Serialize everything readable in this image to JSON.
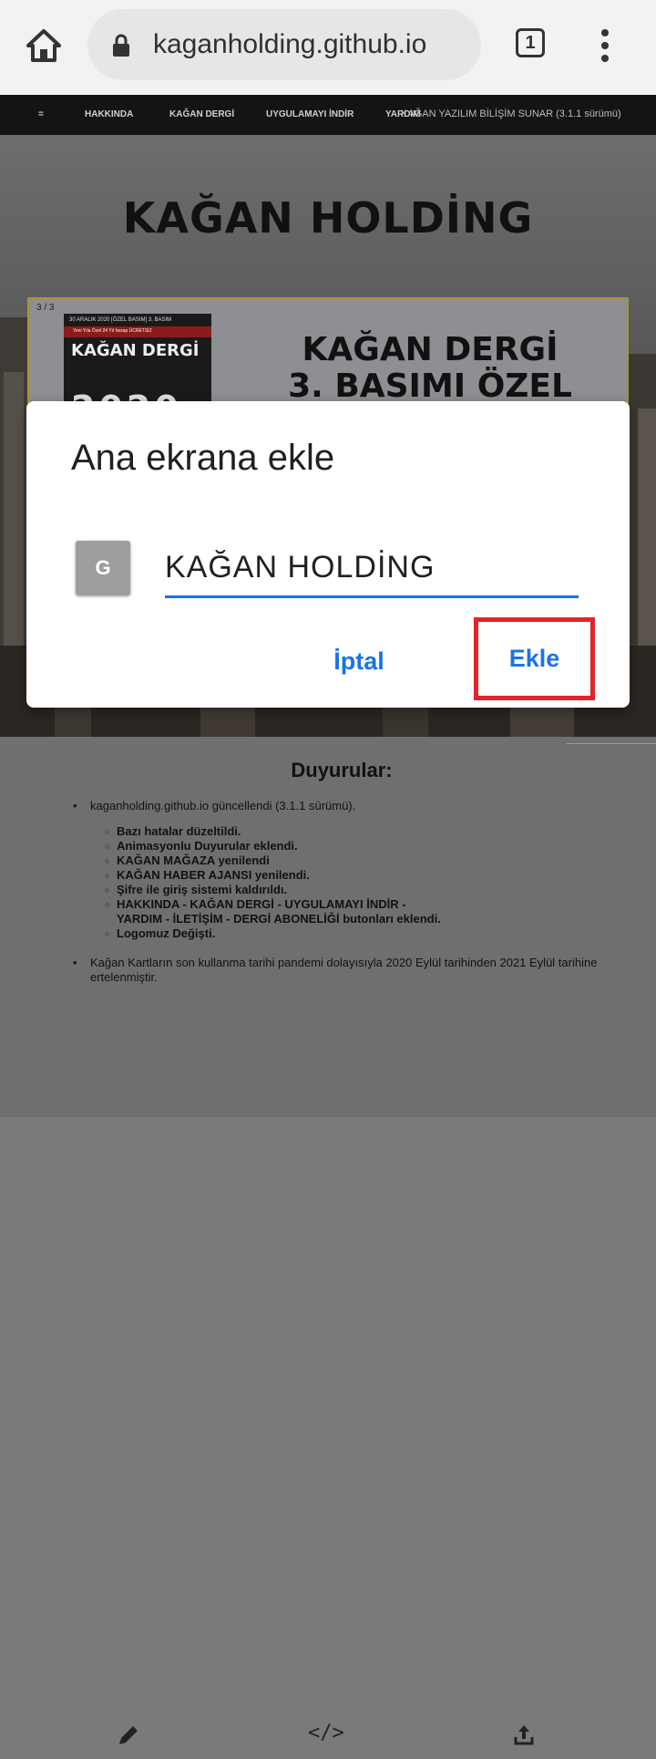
{
  "browser": {
    "url": "kaganholding.github.io",
    "tab_count": "1"
  },
  "navbar": {
    "menu_glyph": "=",
    "items": [
      "HAKKINDA",
      "KAĞAN DERGİ",
      "UYGULAMAYI İNDİR",
      "YARDIM"
    ],
    "credit": "KAĞAN YAZILIM BİLİŞİM SUNAR (3.1.1 sürümü)"
  },
  "hero": {
    "title": "KAĞAN HOLDİNG",
    "slide_counter": "3 / 3",
    "cover": {
      "top_line": "30 ARALIK 2020    [ÖZEL BASIM]    3. BASIM",
      "ribbon": "Yeni Yıla Özel 24 Yıl hesap ÜCRETSİZ",
      "name": "KAĞAN DERGİ",
      "year": "2020"
    },
    "slide_heading_line1": "KAĞAN DERGİ",
    "slide_heading_line2": "3. BASIMI ÖZEL"
  },
  "announcements": {
    "heading": "Duyurular:",
    "items": [
      {
        "text": "kaganholding.github.io güncellendi (3.1.1 sürümü).",
        "subitems": [
          "Bazı hatalar düzeltildi.",
          "Animasyonlu Duyurular eklendi.",
          "KAĞAN MAĞAZA yenilendi",
          "KAĞAN HABER AJANSI yenilendi.",
          "Şifre ile giriş sistemi kaldırıldı.",
          "HAKKINDA - KAĞAN DERGİ - UYGULAMAYI İNDİR - YARDIM - İLETİŞİM - DERGİ ABONELİĞİ butonları eklendi.",
          "Logomuz Değişti."
        ]
      },
      {
        "text": "Kağan Kartların son kullanma tarihi pandemi dolayısıyla 2020 Eylül tarihinden 2021 Eylül tarihine ertelenmiştir."
      }
    ]
  },
  "bottom_bar": {
    "icons": [
      "edit-icon",
      "code-icon",
      "share-icon"
    ],
    "code_glyph": "</>"
  },
  "dialog": {
    "title": "Ana ekrana ekle",
    "app_icon_letter": "G",
    "name_value": "KAĞAN HOLDİNG",
    "cancel_label": "İptal",
    "add_label": "Ekle",
    "accent_color": "#1a73e8",
    "highlight_color": "#e0252b"
  }
}
